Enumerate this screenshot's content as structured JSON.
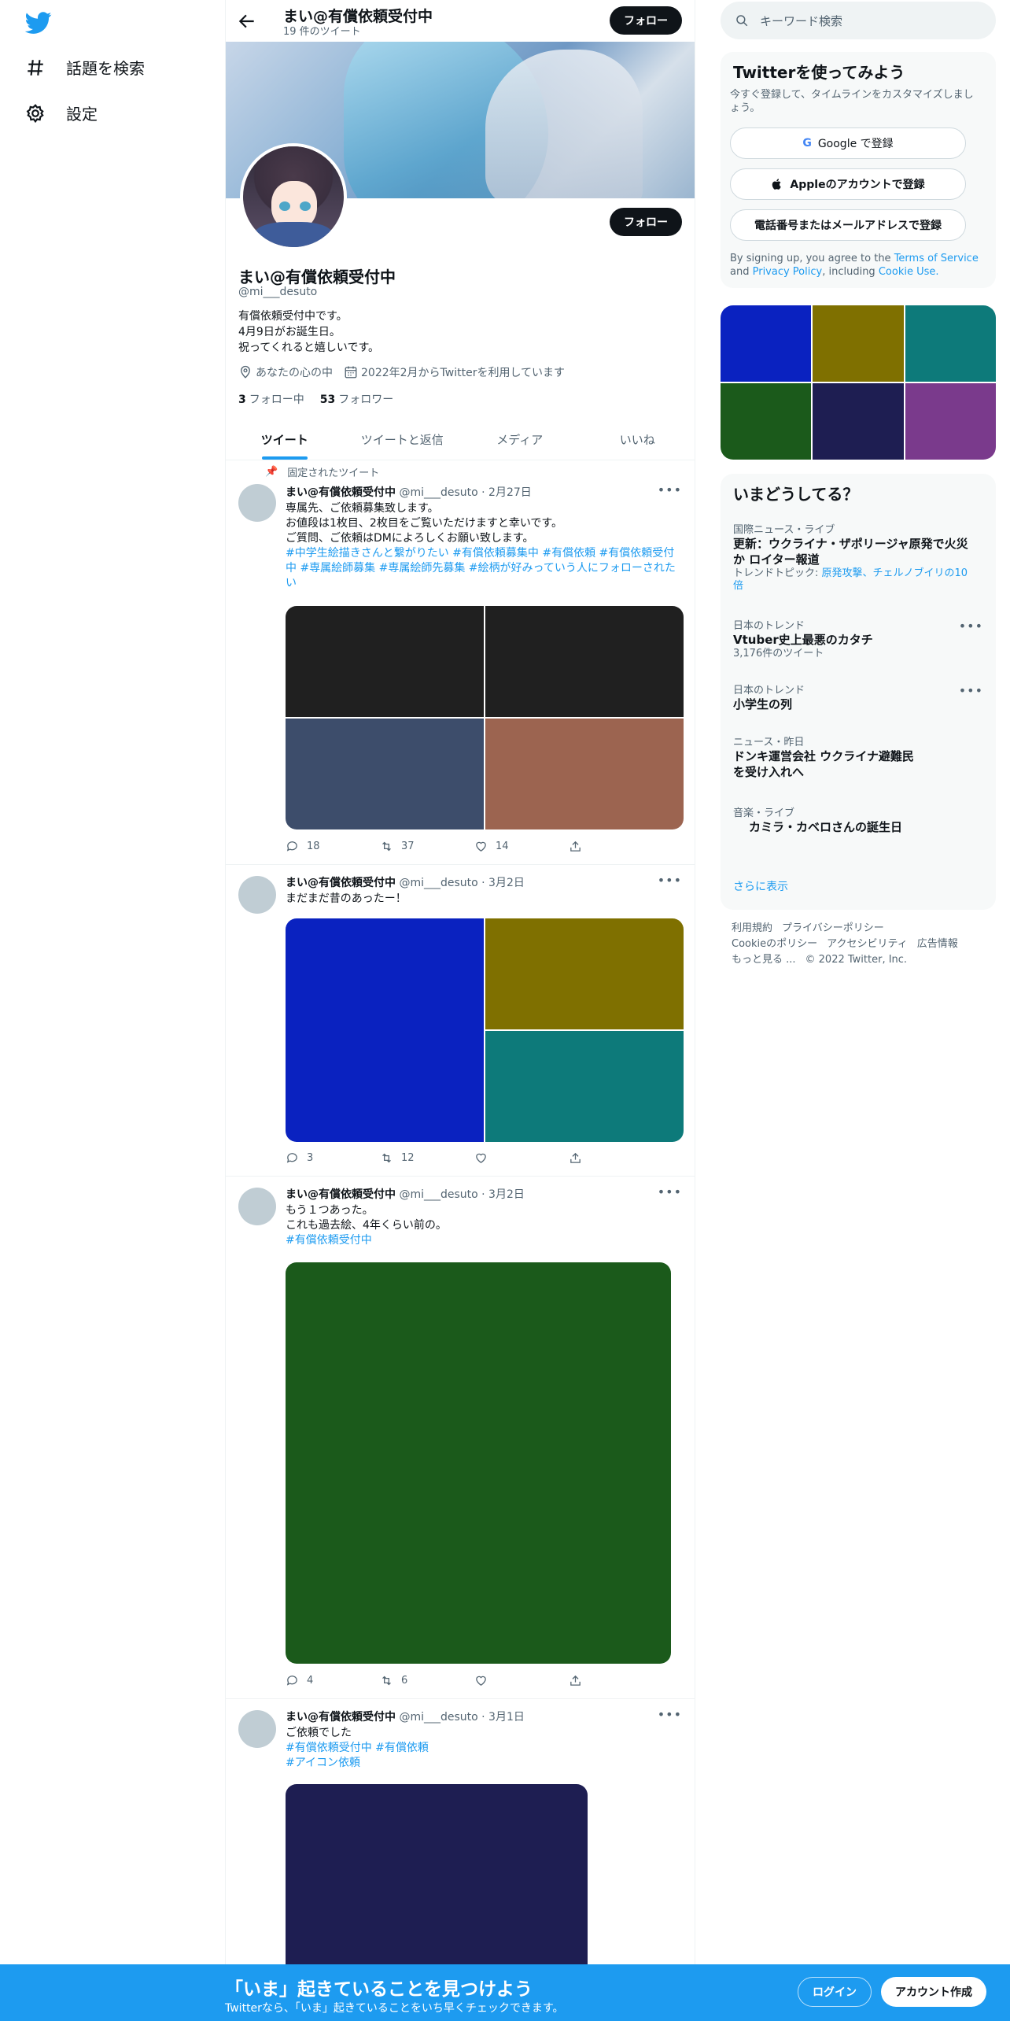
{
  "nav": {
    "explore_label": "話題を検索",
    "settings_label": "設定"
  },
  "header": {
    "name": "まい@有償依頼受付中",
    "tweet_count": "19 件のツイート",
    "follow_label": "フォロー"
  },
  "profile": {
    "name": "まい@有償依頼受付中",
    "handle": "@mi___desuto",
    "bio_lines": [
      "有償依頼受付中です。",
      "4月9日がお誕生日。",
      "祝ってくれると嬉しいです。"
    ],
    "location": "あなたの心の中",
    "joined": "2022年2月からTwitterを利用しています",
    "following_count": "3",
    "following_label": "フォロー中",
    "followers_count": "53",
    "followers_label": "フォロワー",
    "follow_label": "フォロー"
  },
  "tabs": [
    "ツイート",
    "ツイートと返信",
    "メディア",
    "いいね"
  ],
  "pinned_label": "固定されたツイート",
  "tweets": [
    {
      "name": "まい@有償依頼受付中",
      "handle": "@mi___desuto",
      "date": "· 2月27日",
      "lines": [
        "専属先、ご依頼募集致します。",
        "お値段は1枚目、2枚目をご覧いただけますと幸いです。",
        "ご質問、ご依頼はDMによろしくお願い致します。"
      ],
      "tags": "#中学生絵描きさんと繋がりたい #有償依頼募集中 #有償依頼 #有償依頼受付中 #専属絵師募集 #専属絵師先募集 #絵柄が好みっていう人にフォローされたい",
      "media_colors": [
        "#202020",
        "#202020",
        "#3d4d6b",
        "#9c6450"
      ],
      "replies": "18",
      "retweets": "37",
      "likes": "14"
    },
    {
      "name": "まい@有償依頼受付中",
      "handle": "@mi___desuto",
      "date": "· 3月2日",
      "lines": [
        "まだまだ昔のあったー！"
      ],
      "tags": "",
      "media_colors": [
        "#0a22c0",
        "#7f7000",
        "#0d7a7a"
      ],
      "replies": "3",
      "retweets": "12",
      "likes": ""
    },
    {
      "name": "まい@有償依頼受付中",
      "handle": "@mi___desuto",
      "date": "· 3月2日",
      "lines": [
        "もう１つあった。",
        "これも過去絵、4年くらい前の。"
      ],
      "tags": "#有償依頼受付中",
      "media_colors": [
        "#1b5a1b"
      ],
      "replies": "4",
      "retweets": "6",
      "likes": ""
    },
    {
      "name": "まい@有償依頼受付中",
      "handle": "@mi___desuto",
      "date": "· 3月1日",
      "lines": [
        "ご依頼でした"
      ],
      "tags_lines": [
        "#有償依頼受付中 #有償依頼",
        "#アイコン依頼"
      ],
      "media_colors": [
        "#1e1e52"
      ]
    }
  ],
  "right": {
    "search_placeholder": "キーワード検索",
    "signup_card": {
      "title": "Twitterを使ってみよう",
      "subtitle": "今すぐ登録して、タイムラインをカスタマイズしましょう。",
      "google": "Google で登録",
      "apple": "Appleのアカウントで登録",
      "phone": "電話番号またはメールアドレスで登録",
      "legal_prefix": "By signing up, you agree to the",
      "tos": "Terms of Service",
      "and": "and",
      "privacy": "Privacy Policy",
      "including": ", including",
      "cookie": "Cookie Use."
    },
    "media_grid_colors": [
      "#0a22c0",
      "#7f7000",
      "#0d7a7a",
      "#1b5a1b",
      "#1e1e52",
      "#7a3a8c"
    ],
    "trends_title": "いまどうしてる？",
    "trends": [
      {
        "cat": "国際ニュース・ライブ",
        "name": "更新：ウクライナ・ザポリージャ原発で火災か ロイター報道",
        "extra_prefix": "トレンドトピック: ",
        "extra_link": "原発攻撃、チェルノブイリの10倍"
      },
      {
        "cat": "日本のトレンド",
        "name": "Vtuber史上最悪のカタチ",
        "extra": "3,176件のツイート"
      },
      {
        "cat": "日本のトレンド",
        "name": "小学生の列"
      },
      {
        "cat": "ニュース・昨日",
        "name": "ドンキ運営会社 ウクライナ避難民を受け入れへ"
      },
      {
        "cat": "音楽・ライブ",
        "name": "カミラ・カベロさんの誕生日"
      }
    ],
    "show_more": "さらに表示",
    "footer_lines": [
      [
        "利用規約",
        "プライバシーポリシー"
      ],
      [
        "Cookieのポリシー",
        "アクセシビリティ",
        "広告情報"
      ],
      [
        "もっと見る ...",
        "© 2022 Twitter, Inc."
      ]
    ]
  },
  "bottombar": {
    "title": "「いま」起きていることを見つけよう",
    "subtitle": "Twitterなら、「いま」起きていることをいち早くチェックできます。",
    "login": "ログイン",
    "signup": "アカウント作成"
  }
}
